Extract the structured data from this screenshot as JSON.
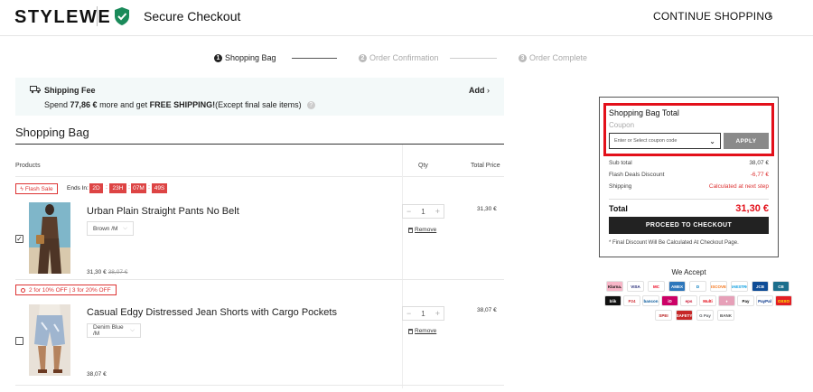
{
  "header": {
    "logo": "STYLEWE",
    "secure_label": "Secure Checkout",
    "continue_label": "CONTINUE SHOPPING",
    "shield_color": "#1a8a5a"
  },
  "steps": [
    {
      "num": "1",
      "label": "Shopping Bag",
      "active": true
    },
    {
      "num": "2",
      "label": "Order Confirmation",
      "active": false
    },
    {
      "num": "3",
      "label": "Order Complete",
      "active": false
    }
  ],
  "shipping": {
    "title": "Shipping Fee",
    "desc_prefix": "Spend ",
    "amount": "77,86 €",
    "desc_middle": " more and get ",
    "free": "FREE SHIPPING!",
    "desc_suffix": "(Except final sale items)",
    "add_label": "Add"
  },
  "bag": {
    "title": "Shopping Bag",
    "col_products": "Products",
    "col_qty": "Qty",
    "col_total": "Total Price"
  },
  "flash": {
    "label": "Flash Sale",
    "ends_in": "Ends In:",
    "countdown": [
      "2D",
      "23H",
      "07M",
      "49S"
    ]
  },
  "products": [
    {
      "name": "Urban Plain Straight Pants No Belt",
      "variant": "Brown /M",
      "price": "31,30 €",
      "old_price": "38,07 €",
      "qty": "1",
      "remove": "Remove",
      "total": "31,30 €",
      "checked": true
    },
    {
      "name": "Casual Edgy Distressed Jean Shorts with Cargo Pockets",
      "variant": "Denim Blue /M",
      "price": "38,07 €",
      "qty": "1",
      "remove": "Remove",
      "total": "38,07 €",
      "checked": false
    }
  ],
  "promo": {
    "label": "2 for 10% OFF | 3 for 20% OFF"
  },
  "summary": {
    "title": "Shopping Bag Total",
    "coupon_label": "Coupon",
    "coupon_placeholder": "Enter or Select coupon code",
    "apply": "APPLY",
    "subtotal_label": "Sub total",
    "subtotal": "38,07 €",
    "flash_label": "Flash Deals Discount",
    "flash_value": "-6,77 €",
    "shipping_label": "Shipping",
    "shipping_value": "Calculated at next step",
    "total_label": "Total",
    "total": "31,30 €",
    "checkout": "PROCEED TO CHECKOUT",
    "note": "* Final Discount Will Be Calculated At Checkout Page."
  },
  "accept": {
    "title": "We Accept",
    "row1": [
      {
        "label": "Klarna.",
        "bg": "#f8b6c8",
        "fg": "#111"
      },
      {
        "label": "VISA",
        "bg": "#ffffff",
        "fg": "#1a1f71"
      },
      {
        "label": "MC",
        "bg": "#ffffff",
        "fg": "#eb001b"
      },
      {
        "label": "AMEX",
        "bg": "#2e77bb",
        "fg": "#ffffff"
      },
      {
        "label": "D",
        "bg": "#ffffff",
        "fg": "#0079be"
      },
      {
        "label": "DISCOVER",
        "bg": "#ffffff",
        "fg": "#f47216"
      },
      {
        "label": "MAESTRO",
        "bg": "#ffffff",
        "fg": "#0099df"
      },
      {
        "label": "JCB",
        "bg": "#0e4c96",
        "fg": "#ffffff"
      },
      {
        "label": "CB",
        "bg": "#1c6e8c",
        "fg": "#ffffff"
      }
    ],
    "row2": [
      {
        "label": "blik",
        "bg": "#111111",
        "fg": "#ffffff"
      },
      {
        "label": "P24",
        "bg": "#ffffff",
        "fg": "#d13239"
      },
      {
        "label": "bancon",
        "bg": "#ffffff",
        "fg": "#005498"
      },
      {
        "label": "iD",
        "bg": "#cc0066",
        "fg": "#ffffff"
      },
      {
        "label": "eps",
        "bg": "#ffffff",
        "fg": "#c8102e"
      },
      {
        "label": "Multi",
        "bg": "#ffffff",
        "fg": "#e30613"
      },
      {
        "label": "♦",
        "bg": "#e6a0b8",
        "fg": "#ffffff"
      },
      {
        "label": "Pay",
        "bg": "#ffffff",
        "fg": "#111111"
      },
      {
        "label": "PayPal",
        "bg": "#ffffff",
        "fg": "#003087"
      },
      {
        "label": "OXXO",
        "bg": "#e31e24",
        "fg": "#ffff00"
      }
    ],
    "row3": [
      {
        "label": "SPEI",
        "bg": "#ffffff",
        "fg": "#b71c1c"
      },
      {
        "label": "SAFETY",
        "bg": "#c62828",
        "fg": "#ffffff"
      },
      {
        "label": "G Pay",
        "bg": "#ffffff",
        "fg": "#5f6368"
      },
      {
        "label": "BANK",
        "bg": "#ffffff",
        "fg": "#555555"
      }
    ]
  }
}
